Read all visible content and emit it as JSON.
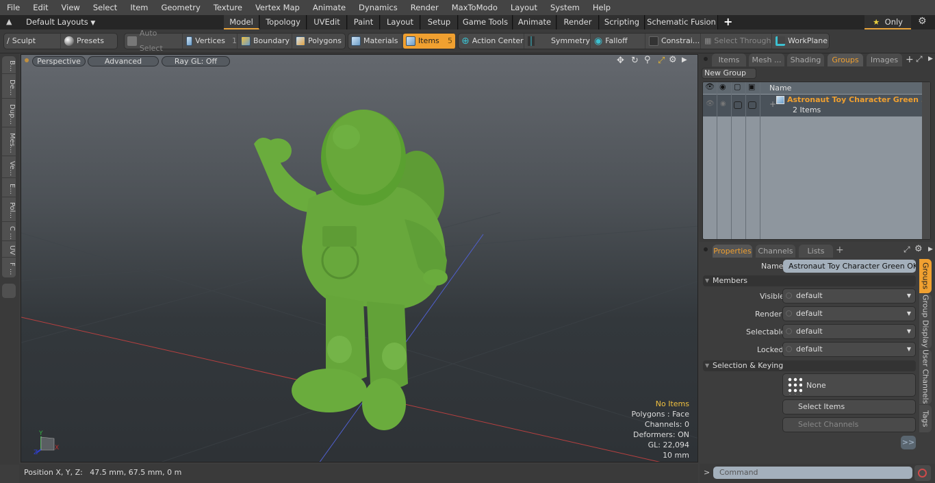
{
  "menu": [
    "File",
    "Edit",
    "View",
    "Select",
    "Item",
    "Geometry",
    "Texture",
    "Vertex Map",
    "Animate",
    "Dynamics",
    "Render",
    "MaxToModo",
    "Layout",
    "System",
    "Help"
  ],
  "layoutbar": {
    "layouts_label": "Default Layouts",
    "tabs": [
      "Model",
      "Topology",
      "UVEdit",
      "Paint",
      "Layout",
      "Setup",
      "Game Tools",
      "Animate",
      "Render",
      "Scripting",
      "Schematic Fusion"
    ],
    "active_tab": "Model",
    "add_tab": "+",
    "only_label": "Only"
  },
  "toolbar": {
    "sculpt": "Sculpt",
    "presets": "Presets",
    "auto_select": "Auto Select",
    "vertices": "Vertices",
    "vertices_count": "1",
    "boundary": "Boundary",
    "polygons": "Polygons",
    "materials": "Materials",
    "items": "Items",
    "items_count": "5",
    "action_center": "Action Center",
    "symmetry": "Symmetry",
    "falloff": "Falloff",
    "constraints": "Constrai...",
    "select_through": "Select Through",
    "workplane": "WorkPlane"
  },
  "left_tabs": [
    "B...",
    "De...",
    "Dup...",
    "Mes...",
    "Ve...",
    "E...",
    "Pol...",
    "C ...",
    "UV",
    "F ..."
  ],
  "viewport": {
    "view_mode": "Perspective",
    "shading": "Advanced",
    "raygl": "Ray GL: Off",
    "stats": {
      "selection": "No Items",
      "polygons": "Polygons : Face",
      "channels": "Channels: 0",
      "deformers": "Deformers: ON",
      "gl": "GL: 22,094",
      "scale": "10 mm"
    },
    "axis_labels": {
      "x": "X",
      "y": "Y",
      "z": "Z"
    },
    "model_color": "#6fb040"
  },
  "statusbar": {
    "position": "Position X, Y, Z:   47.5 mm, 67.5 mm, 0 m"
  },
  "groups_panel": {
    "tabs": [
      "Items",
      "Mesh ...",
      "Shading",
      "Groups",
      "Images"
    ],
    "active_tab": "Groups",
    "new_group": "New Group",
    "column_name": "Name",
    "rows": [
      {
        "name": "Astronaut Toy Character Green ...",
        "sub": "2 Items"
      }
    ]
  },
  "properties_panel": {
    "tabs": [
      "Properties",
      "Channels",
      "Lists"
    ],
    "active_tab": "Properties",
    "name_label": "Name",
    "name_value": "Astronaut Toy Character Green OK Pc",
    "members_section": "Members",
    "fields": [
      {
        "label": "Visible",
        "value": "default"
      },
      {
        "label": "Render",
        "value": "default"
      },
      {
        "label": "Selectable",
        "value": "default"
      },
      {
        "label": "Locked",
        "value": "default"
      }
    ],
    "selection_section": "Selection & Keying",
    "none_label": "None",
    "select_items": "Select Items",
    "select_channels": "Select Channels",
    "more": ">>",
    "side_tabs": [
      "Groups",
      "Group Display",
      "User Channels",
      "Tags"
    ],
    "active_side_tab": "Groups"
  },
  "command": {
    "prompt": ">",
    "placeholder": "Command"
  },
  "colors": {
    "accent": "#f0a030",
    "group_name": "#f0a030"
  }
}
